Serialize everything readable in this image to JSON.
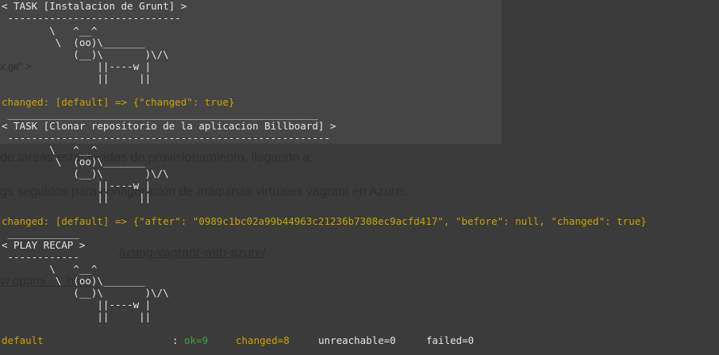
{
  "background_text": {
    "line1": "de tareas establecidas de provisionamiento, llegando a:",
    "line2": "gs seguidos para configuración de máquinas virtuales vagrant en Azure:",
    "line3": "/using-vagrant-with-azure/",
    "line4": "w.optimi ... .html",
    "line5": "x.git\" >"
  },
  "terminal": {
    "task1_header": "< TASK [Instalacion de Grunt] >",
    "task1_dashes": " -----------------------------",
    "cow1_l1": "        \\   ^__^",
    "cow1_l2": "         \\  (oo)\\_______",
    "cow1_l3": "            (__)\\       )\\/\\",
    "cow1_l4": "                ||----w |",
    "cow1_l5": "                ||     ||",
    "task1_result": "changed: [default] => {\"changed\": true}",
    "task2_top": " ____________________________________________________",
    "task2_header": "< TASK [Clonar repositorio de la aplicacion Billboard] >",
    "task2_dashes": " ------------------------------------------------------",
    "task2_result": "changed: [default] => {\"after\": \"0989c1bc02a99b44963c21236b7308ec9acfd417\", \"before\": null, \"changed\": true}",
    "recap_top": " ____________",
    "recap_header": "< PLAY RECAP >",
    "recap_dashes": " ------------",
    "recap_host": "default",
    "recap_colon": ": ",
    "recap_ok": "ok=9",
    "recap_changed": "changed=8",
    "recap_unreachable": "unreachable=0",
    "recap_failed": "failed=0"
  }
}
